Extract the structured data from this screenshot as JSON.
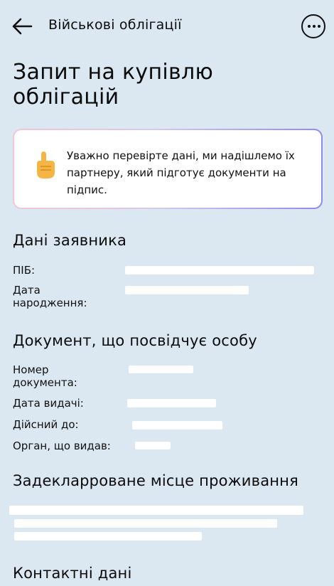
{
  "header": {
    "title": "Військові облігації",
    "back_icon": "arrow-left-icon",
    "menu_icon": "more-icon"
  },
  "page": {
    "title": "Запит на купівлю облігацій"
  },
  "notice": {
    "icon": "pointing-up-hand-icon",
    "text": "Уважно перевірте дані, ми надішлемо їх партнеру, який підготує документи на підпис."
  },
  "applicant": {
    "title": "Дані заявника",
    "name_label": "ПІБ:",
    "birth_label": "Дата народження:"
  },
  "document": {
    "title": "Документ, що посвідчує особу",
    "number_label": "Номер документа:",
    "issue_date_label": "Дата видачі:",
    "valid_until_label": "Дійсний до:",
    "issuer_label": "Орган, що видав:"
  },
  "residence": {
    "title": "Задекларроване місце проживання"
  },
  "contacts": {
    "title": "Контактні дані"
  },
  "colors": {
    "background": "#dbe7f1",
    "card": "#ffffff",
    "accent_border": "#8b8cf0"
  }
}
